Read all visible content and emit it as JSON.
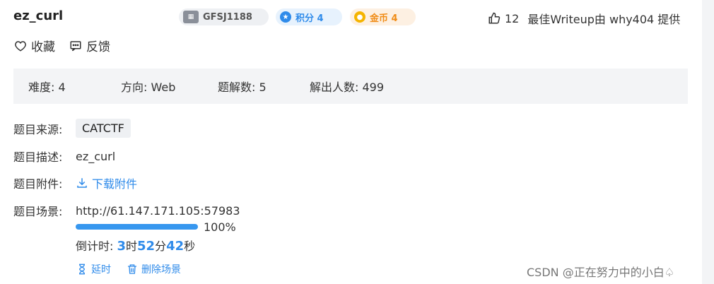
{
  "challenge": {
    "title": "ez_curl",
    "badges": {
      "id": "GFSJ1188",
      "points": "积分 4",
      "gold": "金币 4"
    },
    "likes_count": "12",
    "writeup_text": "最佳Writeup由 why404 提供"
  },
  "actions": {
    "favorite": "收藏",
    "feedback": "反馈"
  },
  "stats": [
    {
      "label": "难度:",
      "value": "4"
    },
    {
      "label": "方向:",
      "value": "Web"
    },
    {
      "label": "题解数:",
      "value": "5"
    },
    {
      "label": "解出人数:",
      "value": "499"
    }
  ],
  "details": {
    "source_label": "题目来源:",
    "source_value": "CATCTF",
    "desc_label": "题目描述:",
    "desc_value": "ez_curl",
    "attach_label": "题目附件:",
    "attach_link": "下载附件",
    "scene_label": "题目场景:",
    "scene_url": "http://61.147.171.105:57983",
    "progress": "100%",
    "countdown_prefix": "倒计时: ",
    "hours": "3",
    "hours_unit": "时",
    "minutes": "52",
    "minutes_unit": "分",
    "seconds": "42",
    "seconds_unit": "秒",
    "extend": "延时",
    "delete_scene": "删除场景"
  },
  "watermark": "CSDN @正在努力中的小白♤",
  "colors": {
    "accent": "#2f8bea",
    "progress": "#3797ef",
    "gold": "#f08c17"
  }
}
